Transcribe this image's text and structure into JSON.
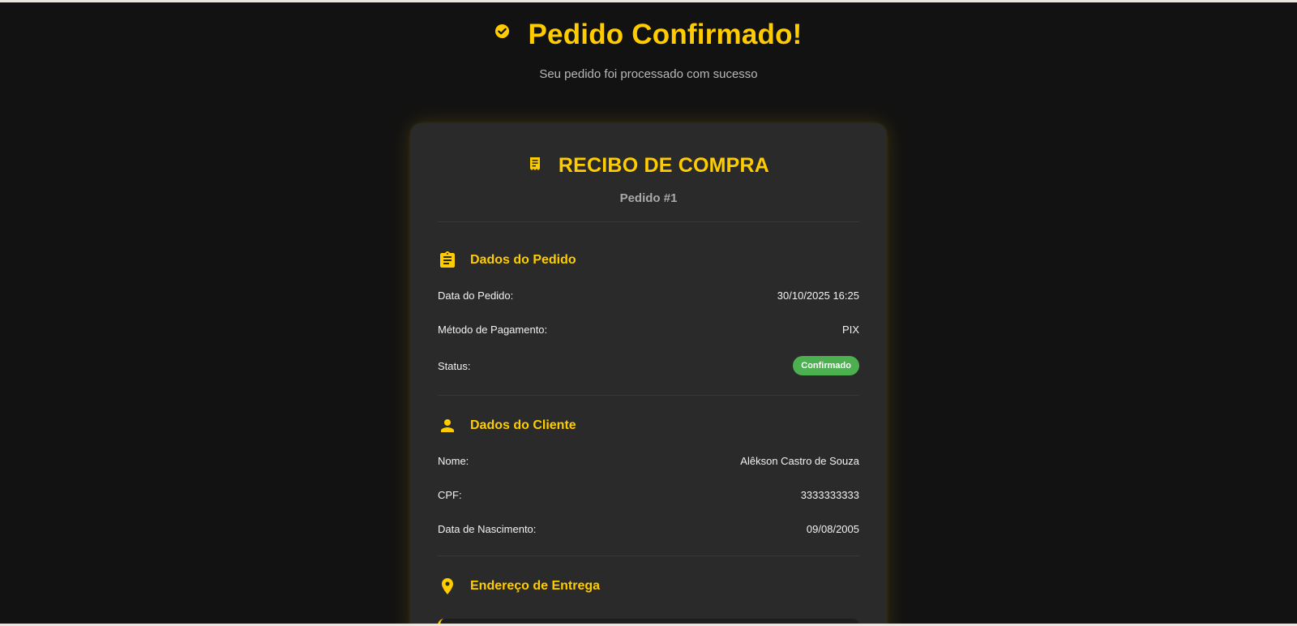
{
  "header": {
    "title": "Pedido Confirmado!",
    "subtitle": "Seu pedido foi processado com sucesso",
    "icon": "check-circle-icon"
  },
  "receipt": {
    "title": "RECIBO DE COMPRA",
    "order_number": "Pedido #1",
    "icon": "receipt-icon"
  },
  "order_section": {
    "title": "Dados do Pedido",
    "icon": "clipboard-icon",
    "rows": [
      {
        "label": "Data do Pedido:",
        "value": "30/10/2025 16:25"
      },
      {
        "label": "Método de Pagamento:",
        "value": "PIX"
      },
      {
        "label": "Status:",
        "value": "Confirmado"
      }
    ]
  },
  "client_section": {
    "title": "Dados do Cliente",
    "icon": "user-icon",
    "rows": [
      {
        "label": "Nome:",
        "value": "Alêkson Castro de Souza"
      },
      {
        "label": "CPF:",
        "value": "3333333333"
      },
      {
        "label": "Data de Nascimento:",
        "value": "09/08/2005"
      }
    ]
  },
  "address_section": {
    "title": "Endereço de Entrega",
    "icon": "map-pin-icon"
  },
  "colors": {
    "background": "#121212",
    "card": "#2a2a2a",
    "accent": "#ffcc00",
    "status_confirmed": "#4caf50"
  }
}
